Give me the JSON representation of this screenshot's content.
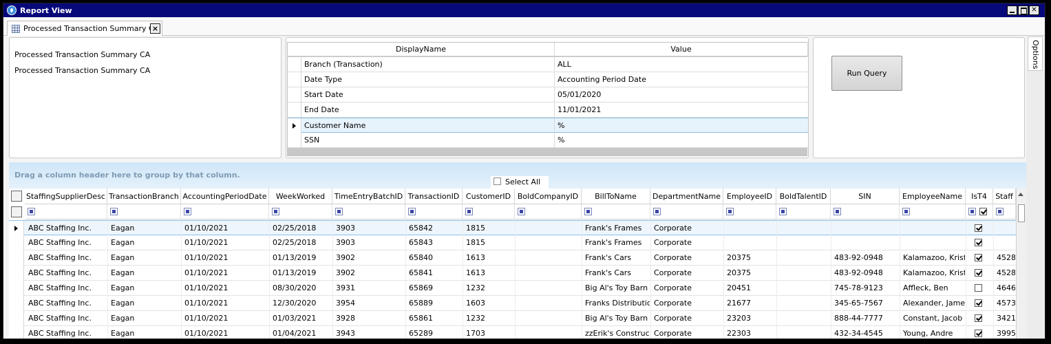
{
  "window": {
    "title": "Report View"
  },
  "tab": {
    "label": "Processed Transaction Summary CA",
    "close": "×"
  },
  "left_panel": {
    "lines": [
      "Processed Transaction Summary CA",
      "Processed Transaction Summary CA"
    ]
  },
  "params": {
    "headers": [
      "DisplayName",
      "Value"
    ],
    "rows": [
      {
        "name": "Branch (Transaction)",
        "value": "ALL"
      },
      {
        "name": "Date Type",
        "value": "Accounting Period Date"
      },
      {
        "name": "Start Date",
        "value": "05/01/2020"
      },
      {
        "name": "End Date",
        "value": "11/01/2021"
      },
      {
        "name": "Customer Name",
        "value": "%"
      },
      {
        "name": "SSN",
        "value": "%"
      }
    ],
    "selected_index": 4
  },
  "run_query": "Run Query",
  "options_tab": "Options",
  "group_hint": "Drag a column header here to group by that column.",
  "select_all": "Select All",
  "grid": {
    "columns": [
      "StaffingSupplierDesc",
      "TransactionBranch",
      "AccountingPeriodDate",
      "WeekWorked",
      "TimeEntryBatchID",
      "TransactionID",
      "CustomerID",
      "BoldCompanyID",
      "BillToName",
      "DepartmentName",
      "EmployeeID",
      "BoldTalentID",
      "SIN",
      "EmployeeName",
      "IsT4",
      "Staff"
    ],
    "rows": [
      [
        "ABC Staffing Inc.",
        "Eagan",
        "01/10/2021",
        "02/25/2018",
        "3903",
        "65842",
        "1815",
        "",
        "Frank's Frames",
        "Corporate",
        "",
        "",
        "",
        "",
        true,
        ""
      ],
      [
        "ABC Staffing Inc.",
        "Eagan",
        "01/10/2021",
        "02/25/2018",
        "3903",
        "65843",
        "1815",
        "",
        "Frank's Frames",
        "Corporate",
        "",
        "",
        "",
        "",
        true,
        ""
      ],
      [
        "ABC Staffing Inc.",
        "Eagan",
        "01/10/2021",
        "01/13/2019",
        "3902",
        "65840",
        "1613",
        "",
        "Frank's Cars",
        "Corporate",
        "20375",
        "",
        "483-92-0948",
        "Kalamazoo, Kriste",
        true,
        "4528"
      ],
      [
        "ABC Staffing Inc.",
        "Eagan",
        "01/10/2021",
        "01/13/2019",
        "3902",
        "65841",
        "1613",
        "",
        "Frank's Cars",
        "Corporate",
        "20375",
        "",
        "483-92-0948",
        "Kalamazoo, Kriste",
        true,
        "4528"
      ],
      [
        "ABC Staffing Inc.",
        "Eagan",
        "01/10/2021",
        "08/30/2020",
        "3931",
        "65869",
        "1232",
        "",
        "Big Al's Toy Barn",
        "Corporate",
        "20451",
        "",
        "745-78-9123",
        "Affleck, Ben",
        false,
        "4646"
      ],
      [
        "ABC Staffing Inc.",
        "Eagan",
        "01/10/2021",
        "12/30/2020",
        "3954",
        "65889",
        "1603",
        "",
        "Franks Distributio",
        "Corporate",
        "21677",
        "",
        "345-65-7567",
        "Alexander, James",
        true,
        "4573"
      ],
      [
        "ABC Staffing Inc.",
        "Eagan",
        "01/10/2021",
        "01/03/2021",
        "3928",
        "65861",
        "1232",
        "",
        "Big Al's Toy Barn",
        "Corporate",
        "23203",
        "",
        "888-44-7777",
        "Constant, Jacob",
        true,
        "3421"
      ],
      [
        "ABC Staffing Inc.",
        "Eagan",
        "01/10/2021",
        "01/04/2021",
        "3943",
        "65289",
        "1703",
        "",
        "zzErik's Constructi",
        "Corporate",
        "22303",
        "",
        "432-34-4545",
        "Young, Andre",
        true,
        "3995"
      ]
    ],
    "selected_index": 0
  }
}
